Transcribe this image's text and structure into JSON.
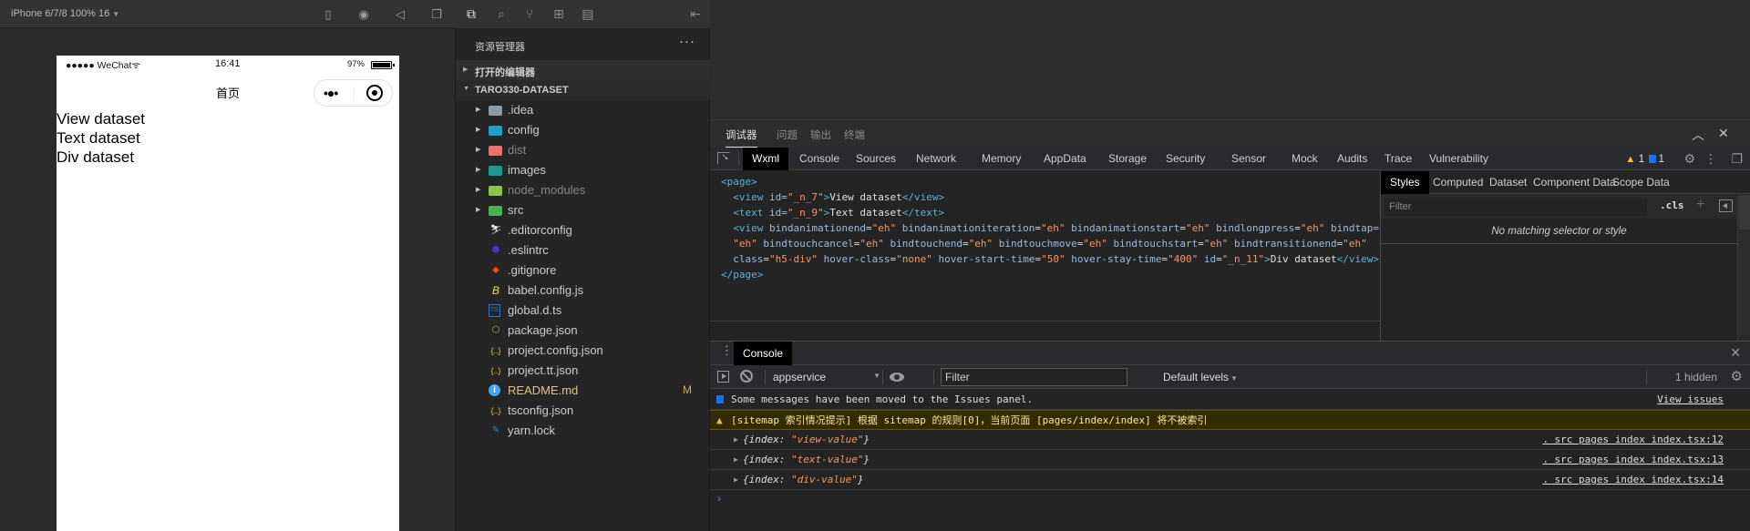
{
  "simulator": {
    "device_label": "iPhone 6/7/8 100% 16",
    "toolbar_icons": [
      "phone-icon",
      "record-icon",
      "sound-icon",
      "window-icon"
    ],
    "status_bar": {
      "carrier": "●●●●● WeChat",
      "wifi": "ᯤ",
      "time": "16:41",
      "battery": "97%"
    },
    "nav_title": "首页",
    "capsule": {
      "more": "•●•"
    },
    "content": [
      "View dataset",
      "Text dataset",
      "Div dataset"
    ]
  },
  "explorer": {
    "title": "资源管理器",
    "more": "···",
    "open_editors": "打开的编辑器",
    "project": "TARO330-DATASET",
    "files": [
      {
        "name": ".idea",
        "type": "folder",
        "color": "#8c9ba5",
        "state": ""
      },
      {
        "name": "config",
        "type": "folder",
        "color": "#20a0c8",
        "state": ""
      },
      {
        "name": "dist",
        "type": "folder",
        "color": "#e57373",
        "state": "dim"
      },
      {
        "name": "images",
        "type": "folder",
        "color": "#1c9c8c",
        "state": ""
      },
      {
        "name": "node_modules",
        "type": "folder",
        "color": "#8bc34a",
        "state": "dim"
      },
      {
        "name": "src",
        "type": "folder",
        "color": "#4caf50",
        "state": ""
      },
      {
        "name": ".editorconfig",
        "type": "file",
        "icon": "editorconfig-icon",
        "glyph": "⛷",
        "color": "#e8e8e8",
        "state": ""
      },
      {
        "name": ".eslintrc",
        "type": "file",
        "icon": "eslint-icon",
        "glyph": "⬢",
        "color": "#4b32c3",
        "state": ""
      },
      {
        "name": ".gitignore",
        "type": "file",
        "icon": "git-icon",
        "glyph": "◆",
        "color": "#e64a19",
        "state": ""
      },
      {
        "name": "babel.config.js",
        "type": "file",
        "icon": "babel-icon",
        "glyph": "B",
        "color": "#f5da55",
        "state": ""
      },
      {
        "name": "global.d.ts",
        "type": "file",
        "icon": "typescript-icon",
        "glyph": "TS",
        "color": "#2f74c0",
        "state": ""
      },
      {
        "name": "package.json",
        "type": "file",
        "icon": "nodejs-icon",
        "glyph": "⬡",
        "color": "#8bc34a",
        "state": ""
      },
      {
        "name": "project.config.json",
        "type": "file",
        "icon": "json-icon",
        "glyph": "{..}",
        "color": "#f5c518",
        "state": ""
      },
      {
        "name": "project.tt.json",
        "type": "file",
        "icon": "json-icon",
        "glyph": "{..}",
        "color": "#f5c518",
        "state": ""
      },
      {
        "name": "README.md",
        "type": "file",
        "icon": "info-icon",
        "glyph": "i",
        "color": "#42a5f5",
        "state": "modified",
        "badge": "M"
      },
      {
        "name": "tsconfig.json",
        "type": "file",
        "icon": "json-icon",
        "glyph": "{..}",
        "color": "#f5c518",
        "state": ""
      },
      {
        "name": "yarn.lock",
        "type": "file",
        "icon": "yarn-icon",
        "glyph": "✎",
        "color": "#2c8ebb",
        "state": ""
      }
    ]
  },
  "panel": {
    "tabs": [
      "调试器",
      "问题",
      "输出",
      "终端"
    ],
    "active_tab": 0
  },
  "devtools": {
    "tabs": [
      "Wxml",
      "Console",
      "Sources",
      "Network",
      "Memory",
      "AppData",
      "Storage",
      "Security",
      "Sensor",
      "Mock",
      "Audits",
      "Trace",
      "Vulnerability"
    ],
    "active_tab": "Wxml",
    "warnings": "1",
    "messages": "1",
    "wxml": {
      "page_open": "<page>",
      "page_close": "</page>",
      "line1": {
        "tag": "view",
        "id": "_n_7",
        "text": "View dataset"
      },
      "line2": {
        "tag": "text",
        "id": "_n_9",
        "text": "Text dataset"
      },
      "line3a": [
        [
          "bindanimationend",
          "eh"
        ],
        [
          "bindanimationiteration",
          "eh"
        ],
        [
          "bindanimationstart",
          "eh"
        ],
        [
          "bindlongpress",
          "eh"
        ]
      ],
      "line3a_tail": "bindtap=",
      "line3b_head": "\"eh\"",
      "line3b": [
        [
          "bindtouchcancel",
          "eh"
        ],
        [
          "bindtouchend",
          "eh"
        ],
        [
          "bindtouchmove",
          "eh"
        ],
        [
          "bindtouchstart",
          "eh"
        ],
        [
          "bindtransitionend",
          "eh"
        ]
      ],
      "line3c": [
        [
          "class",
          "h5-div"
        ],
        [
          "hover-class",
          "none"
        ],
        [
          "hover-start-time",
          "50"
        ],
        [
          "hover-stay-time",
          "400"
        ],
        [
          "id",
          "_n_11"
        ]
      ],
      "line3_text": "Div dataset",
      "line3_close": "</view>"
    },
    "styles": {
      "tabs": [
        "Styles",
        "Computed",
        "Dataset",
        "Component Data",
        "Scope Data"
      ],
      "filter_placeholder": "Filter",
      "cls": ".cls",
      "plus": "+",
      "empty": "No matching selector or style"
    }
  },
  "console": {
    "tab": "Console",
    "context": "appservice",
    "filter_placeholder": "Filter",
    "levels": "Default levels",
    "hidden": "1 hidden",
    "messages": [
      {
        "kind": "info",
        "text": "Some messages have been moved to the Issues panel.",
        "link": "View issues"
      },
      {
        "kind": "warn",
        "text": "[sitemap 索引情况提示] 根据 sitemap 的规则[0]，当前页面 [pages/index/index] 将不被索引"
      },
      {
        "kind": "log",
        "key": "index",
        "value": "\"view-value\"",
        "link": ". src pages index index.tsx:12"
      },
      {
        "kind": "log",
        "key": "index",
        "value": "\"text-value\"",
        "link": ". src pages index index.tsx:13"
      },
      {
        "kind": "log",
        "key": "index",
        "value": "\"div-value\"",
        "link": ". src pages index index.tsx:14"
      }
    ],
    "prompt": "›"
  }
}
